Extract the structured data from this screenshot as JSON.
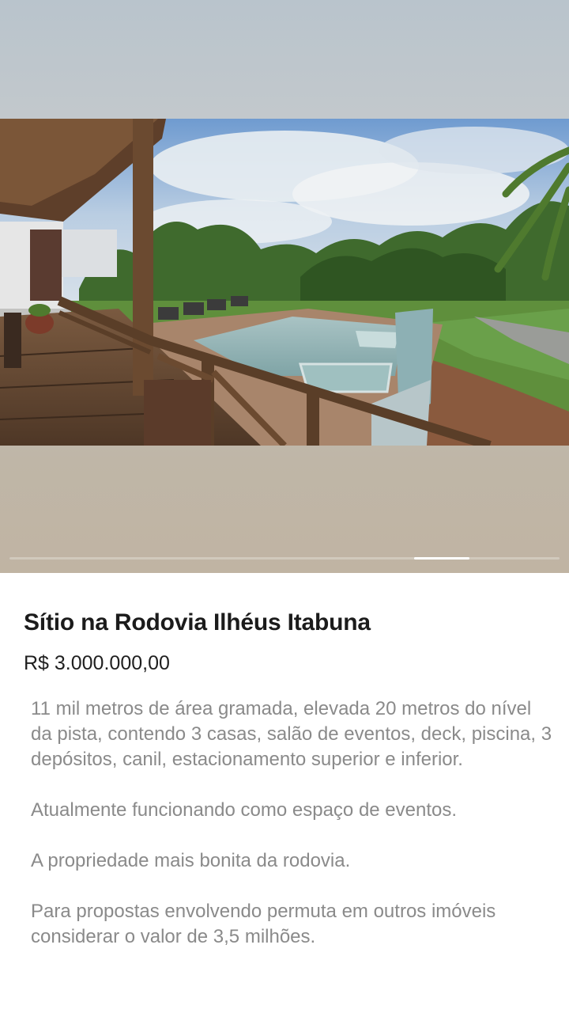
{
  "gallery": {
    "current_index": 6,
    "total_count": 7
  },
  "listing": {
    "title": "Sítio na Rodovia Ilhéus Itabuna",
    "price": "R$ 3.000.000,00",
    "description": [
      "11 mil metros de área gramada, elevada 20 metros do nível da pista, contendo 3 casas, salão de eventos, deck, piscina, 3 depósitos, canil, estacionamento superior e inferior.",
      "Atualmente funcionando como espaço de eventos.",
      "A propriedade mais bonita da rodovia.",
      "Para propostas envolvendo permuta em outros imóveis considerar o valor de 3,5 milhões."
    ]
  }
}
